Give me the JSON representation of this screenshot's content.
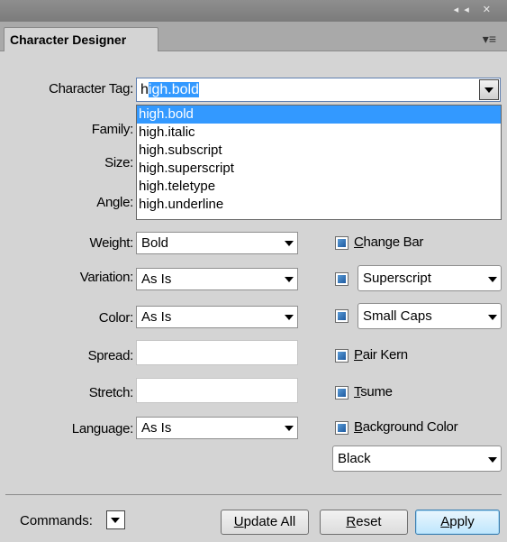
{
  "window": {
    "title_controls": "◂◂ ✕"
  },
  "tab": {
    "label": "Character Designer",
    "menu_icon": "▾≡"
  },
  "labels": {
    "character_tag": "Character Tag:",
    "family": "Family:",
    "size": "Size:",
    "angle": "Angle:",
    "weight": "Weight:",
    "variation": "Variation:",
    "color": "Color:",
    "spread": "Spread:",
    "stretch": "Stretch:",
    "language": "Language:",
    "commands": "Commands:"
  },
  "character_tag": {
    "prefix": "h",
    "selected_text": "igh.bold"
  },
  "dropdown": {
    "items": [
      "high.bold",
      "high.italic",
      "high.subscript",
      "high.superscript",
      "high.teletype",
      "high.underline"
    ],
    "selected_index": 0
  },
  "fields": {
    "weight": "Bold",
    "variation": "As Is",
    "color": "As Is",
    "spread": "",
    "stretch": "",
    "language": "As Is"
  },
  "checkboxes": {
    "change_bar": {
      "underlined_letter": "C",
      "rest": "hange Bar"
    },
    "superscript": {
      "select_value": "Superscript"
    },
    "small_caps": {
      "select_value": "Small Caps"
    },
    "pair_kern": {
      "underlined_letter": "P",
      "rest": "air Kern"
    },
    "tsume": {
      "underlined_letter": "T",
      "rest": "sume"
    },
    "background_color": {
      "underlined_letter": "B",
      "rest": "ackground Color"
    }
  },
  "background_color_value": "Black",
  "buttons": {
    "update_all": {
      "underlined_letter": "U",
      "rest": "pdate All"
    },
    "reset": {
      "underlined_letter": "R",
      "rest": "eset"
    },
    "apply": {
      "underlined_letter": "A",
      "rest": "pply"
    }
  },
  "colors": {
    "selection": "#3399ff",
    "panel": "#d4d4d4"
  }
}
